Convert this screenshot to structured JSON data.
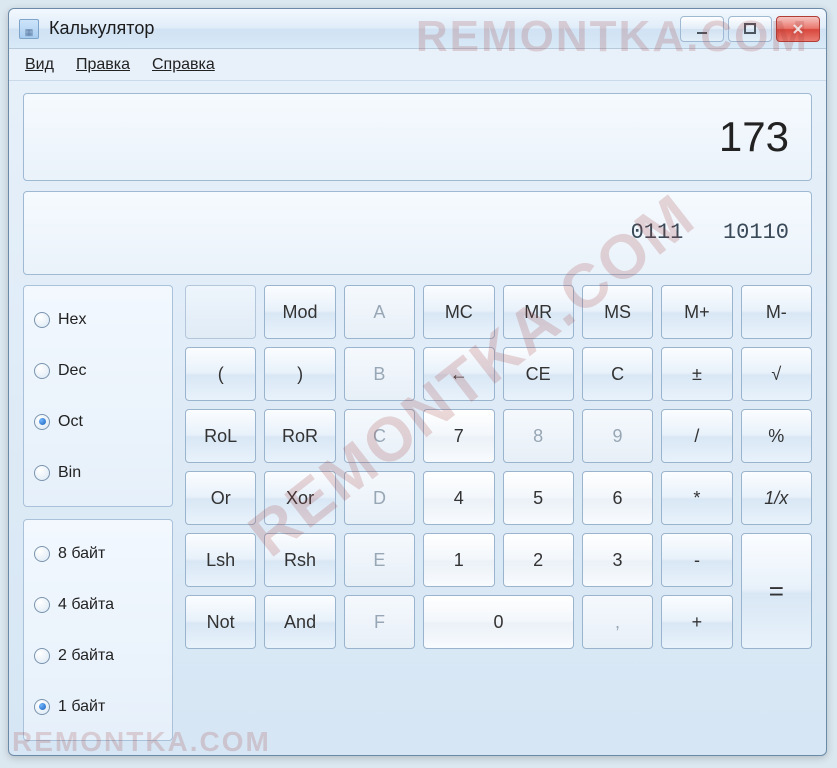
{
  "window": {
    "title": "Калькулятор"
  },
  "menu": {
    "view": "Вид",
    "edit": "Правка",
    "help": "Справка"
  },
  "display": {
    "value": "173"
  },
  "bits": {
    "line1": "0111   1011",
    "line2": "0"
  },
  "base_panel": {
    "hex": "Hex",
    "dec": "Dec",
    "oct": "Oct",
    "bin": "Bin",
    "selected": "oct"
  },
  "word_panel": {
    "b8": "8 байт",
    "b4": "4 байта",
    "b2": "2 байта",
    "b1": "1 байт",
    "selected": "b1"
  },
  "buttons": {
    "mod": "Mod",
    "a": "A",
    "mc": "MC",
    "mr": "MR",
    "ms": "MS",
    "mplus": "M+",
    "mminus": "M-",
    "lparen": "(",
    "rparen": ")",
    "b": "B",
    "back": "←",
    "ce": "CE",
    "c": "C",
    "pm": "±",
    "sqrt": "√",
    "rol": "RoL",
    "ror": "RoR",
    "cC": "C",
    "d7": "7",
    "d8": "8",
    "d9": "9",
    "div": "/",
    "pct": "%",
    "or": "Or",
    "xor": "Xor",
    "dD": "D",
    "d4": "4",
    "d5": "5",
    "d6": "6",
    "mul": "*",
    "inv": "1/x",
    "lsh": "Lsh",
    "rsh": "Rsh",
    "eE": "E",
    "d1": "1",
    "d2": "2",
    "d3": "3",
    "sub": "-",
    "eq": "=",
    "not": "Not",
    "and": "And",
    "fF": "F",
    "d0": "0",
    "dot": ",",
    "add": "+"
  },
  "watermark": "REMONTKA.COM"
}
